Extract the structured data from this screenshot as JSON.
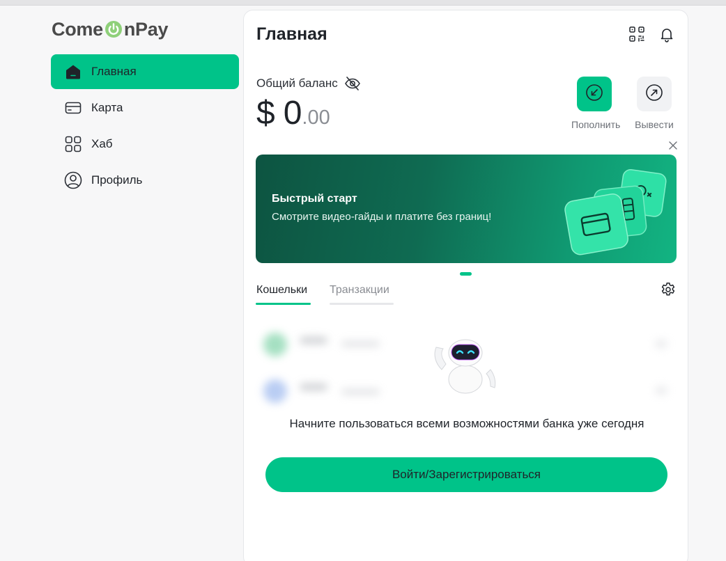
{
  "brand": {
    "name_left": "Come",
    "name_right": "nPay",
    "accent": "#00c389"
  },
  "sidebar": {
    "items": [
      {
        "label": "Главная",
        "icon": "home-icon",
        "active": true
      },
      {
        "label": "Карта",
        "icon": "card-icon",
        "active": false
      },
      {
        "label": "Хаб",
        "icon": "grid-icon",
        "active": false
      },
      {
        "label": "Профиль",
        "icon": "user-icon",
        "active": false
      }
    ]
  },
  "header": {
    "title": "Главная",
    "icons": [
      "qr-code-icon",
      "bell-icon"
    ]
  },
  "balance": {
    "label": "Общий баланс",
    "currency": "$",
    "integer": "0",
    "decimals": ".00",
    "visibility_icon": "eye-off-icon"
  },
  "actions": {
    "deposit": {
      "label": "Пополнить",
      "icon": "arrow-down-left-icon"
    },
    "withdraw": {
      "label": "Вывести",
      "icon": "arrow-up-right-icon"
    }
  },
  "banner": {
    "title": "Быстрый старт",
    "subtitle": "Смотрите видео-гайды и платите без границ!"
  },
  "tabs": [
    {
      "label": "Кошельки",
      "active": true
    },
    {
      "label": "Транзакции",
      "active": false
    }
  ],
  "empty_state": {
    "text": "Начните пользоваться всеми возможностями банка уже сегодня",
    "button_label": "Войти/Зарегистрироваться"
  }
}
